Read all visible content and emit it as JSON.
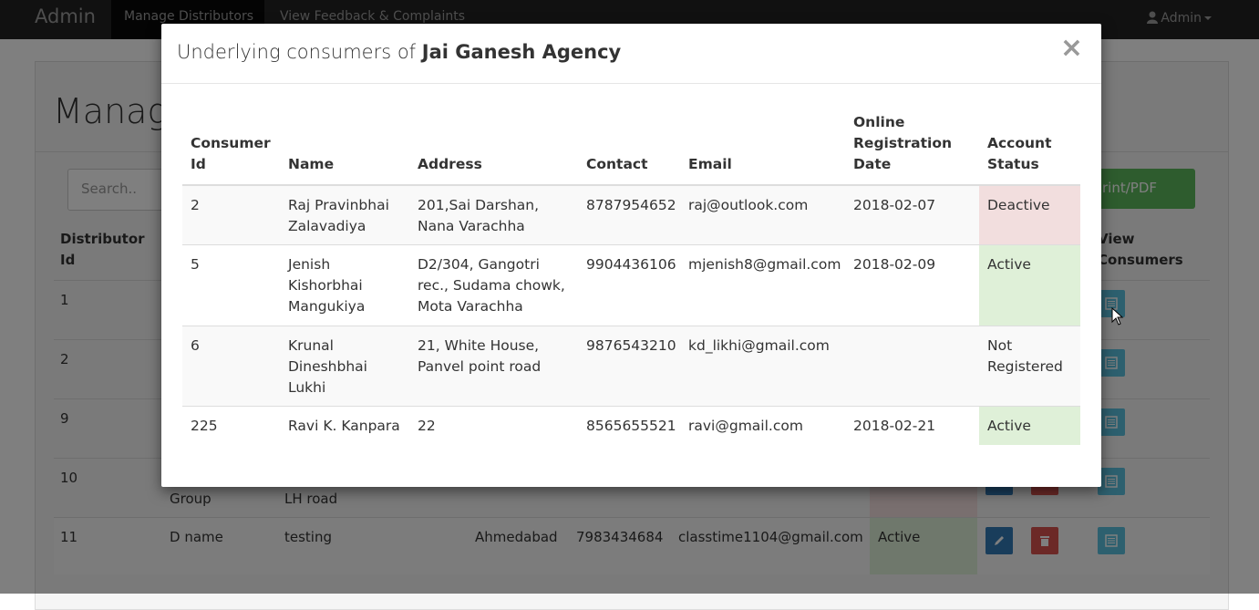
{
  "navbar": {
    "brand": "Admin",
    "links": [
      "Manage Distributors",
      "View Feedback & Complaints"
    ],
    "user": "Admin"
  },
  "page": {
    "title": "Manage",
    "search_placeholder": "Search..",
    "print_label": "rint/PDF",
    "headers": {
      "distributor_id": [
        "Distributor",
        "Id"
      ],
      "view_consumers": [
        "View",
        "Consumers"
      ]
    },
    "rows": [
      {
        "id": "1"
      },
      {
        "id": "2"
      },
      {
        "id": "9"
      },
      {
        "id": "10",
        "name_partial": "Group",
        "address_partial": "LH road"
      },
      {
        "id": "11",
        "name": "D name",
        "address": "testing",
        "city": "Ahmedabad",
        "contact": "7983434684",
        "email": "classtime1104@gmail.com",
        "status": "Active"
      }
    ]
  },
  "modal": {
    "title_prefix": "Underlying consumers of ",
    "agency": "Jai Ganesh Agency",
    "close": "×",
    "columns": {
      "consumer_id": [
        "Consumer",
        "Id"
      ],
      "name": "Name",
      "address": "Address",
      "contact": "Contact",
      "email": "Email",
      "reg_date": [
        "Online",
        "Registration",
        "Date"
      ],
      "status": [
        "Account",
        "Status"
      ]
    },
    "rows": [
      {
        "id": "2",
        "name": [
          "Raj Pravinbhai",
          "Zalavadiya"
        ],
        "address": [
          "201,Sai Darshan,",
          "Nana Varachha"
        ],
        "contact": "8787954652",
        "email": "raj@outlook.com",
        "date": "2018-02-07",
        "status": [
          "Deactive"
        ],
        "status_color": "#f2dede"
      },
      {
        "id": "5",
        "name": [
          "Jenish",
          "Kishorbhai",
          "Mangukiya"
        ],
        "address": [
          "D2/304, Gangotri",
          "rec., Sudama chowk,",
          "Mota Varachha"
        ],
        "contact": "9904436106",
        "email": "mjenish8@gmail.com",
        "date": "2018-02-09",
        "status": [
          "Active"
        ],
        "status_color": "#dff0d8"
      },
      {
        "id": "6",
        "name": [
          "Krunal",
          "Dineshbhai",
          "Lukhi"
        ],
        "address": [
          "21, White House,",
          "Panvel point road"
        ],
        "contact": "9876543210",
        "email": "kd_likhi@gmail.com",
        "date": "",
        "status": [
          "Not",
          "Registered"
        ],
        "status_color": ""
      },
      {
        "id": "225",
        "name": [
          "Ravi K. Kanpara"
        ],
        "address": [
          "22"
        ],
        "contact": "8565655521",
        "email": "ravi@gmail.com",
        "date": "2018-02-21",
        "status": [
          "Active"
        ],
        "status_color": "#dff0d8"
      }
    ]
  },
  "icons": {
    "user": "user-icon",
    "edit": "pencil-icon",
    "delete": "trash-icon",
    "list": "list-icon",
    "cursor": "mouse-pointer-icon"
  },
  "colors": {
    "navbar": "#222222",
    "success": "#5cb85c",
    "primary": "#337ab7",
    "danger": "#d9534f",
    "info": "#5bc0de",
    "row_danger": "#f2dede",
    "row_success": "#dff0d8"
  }
}
